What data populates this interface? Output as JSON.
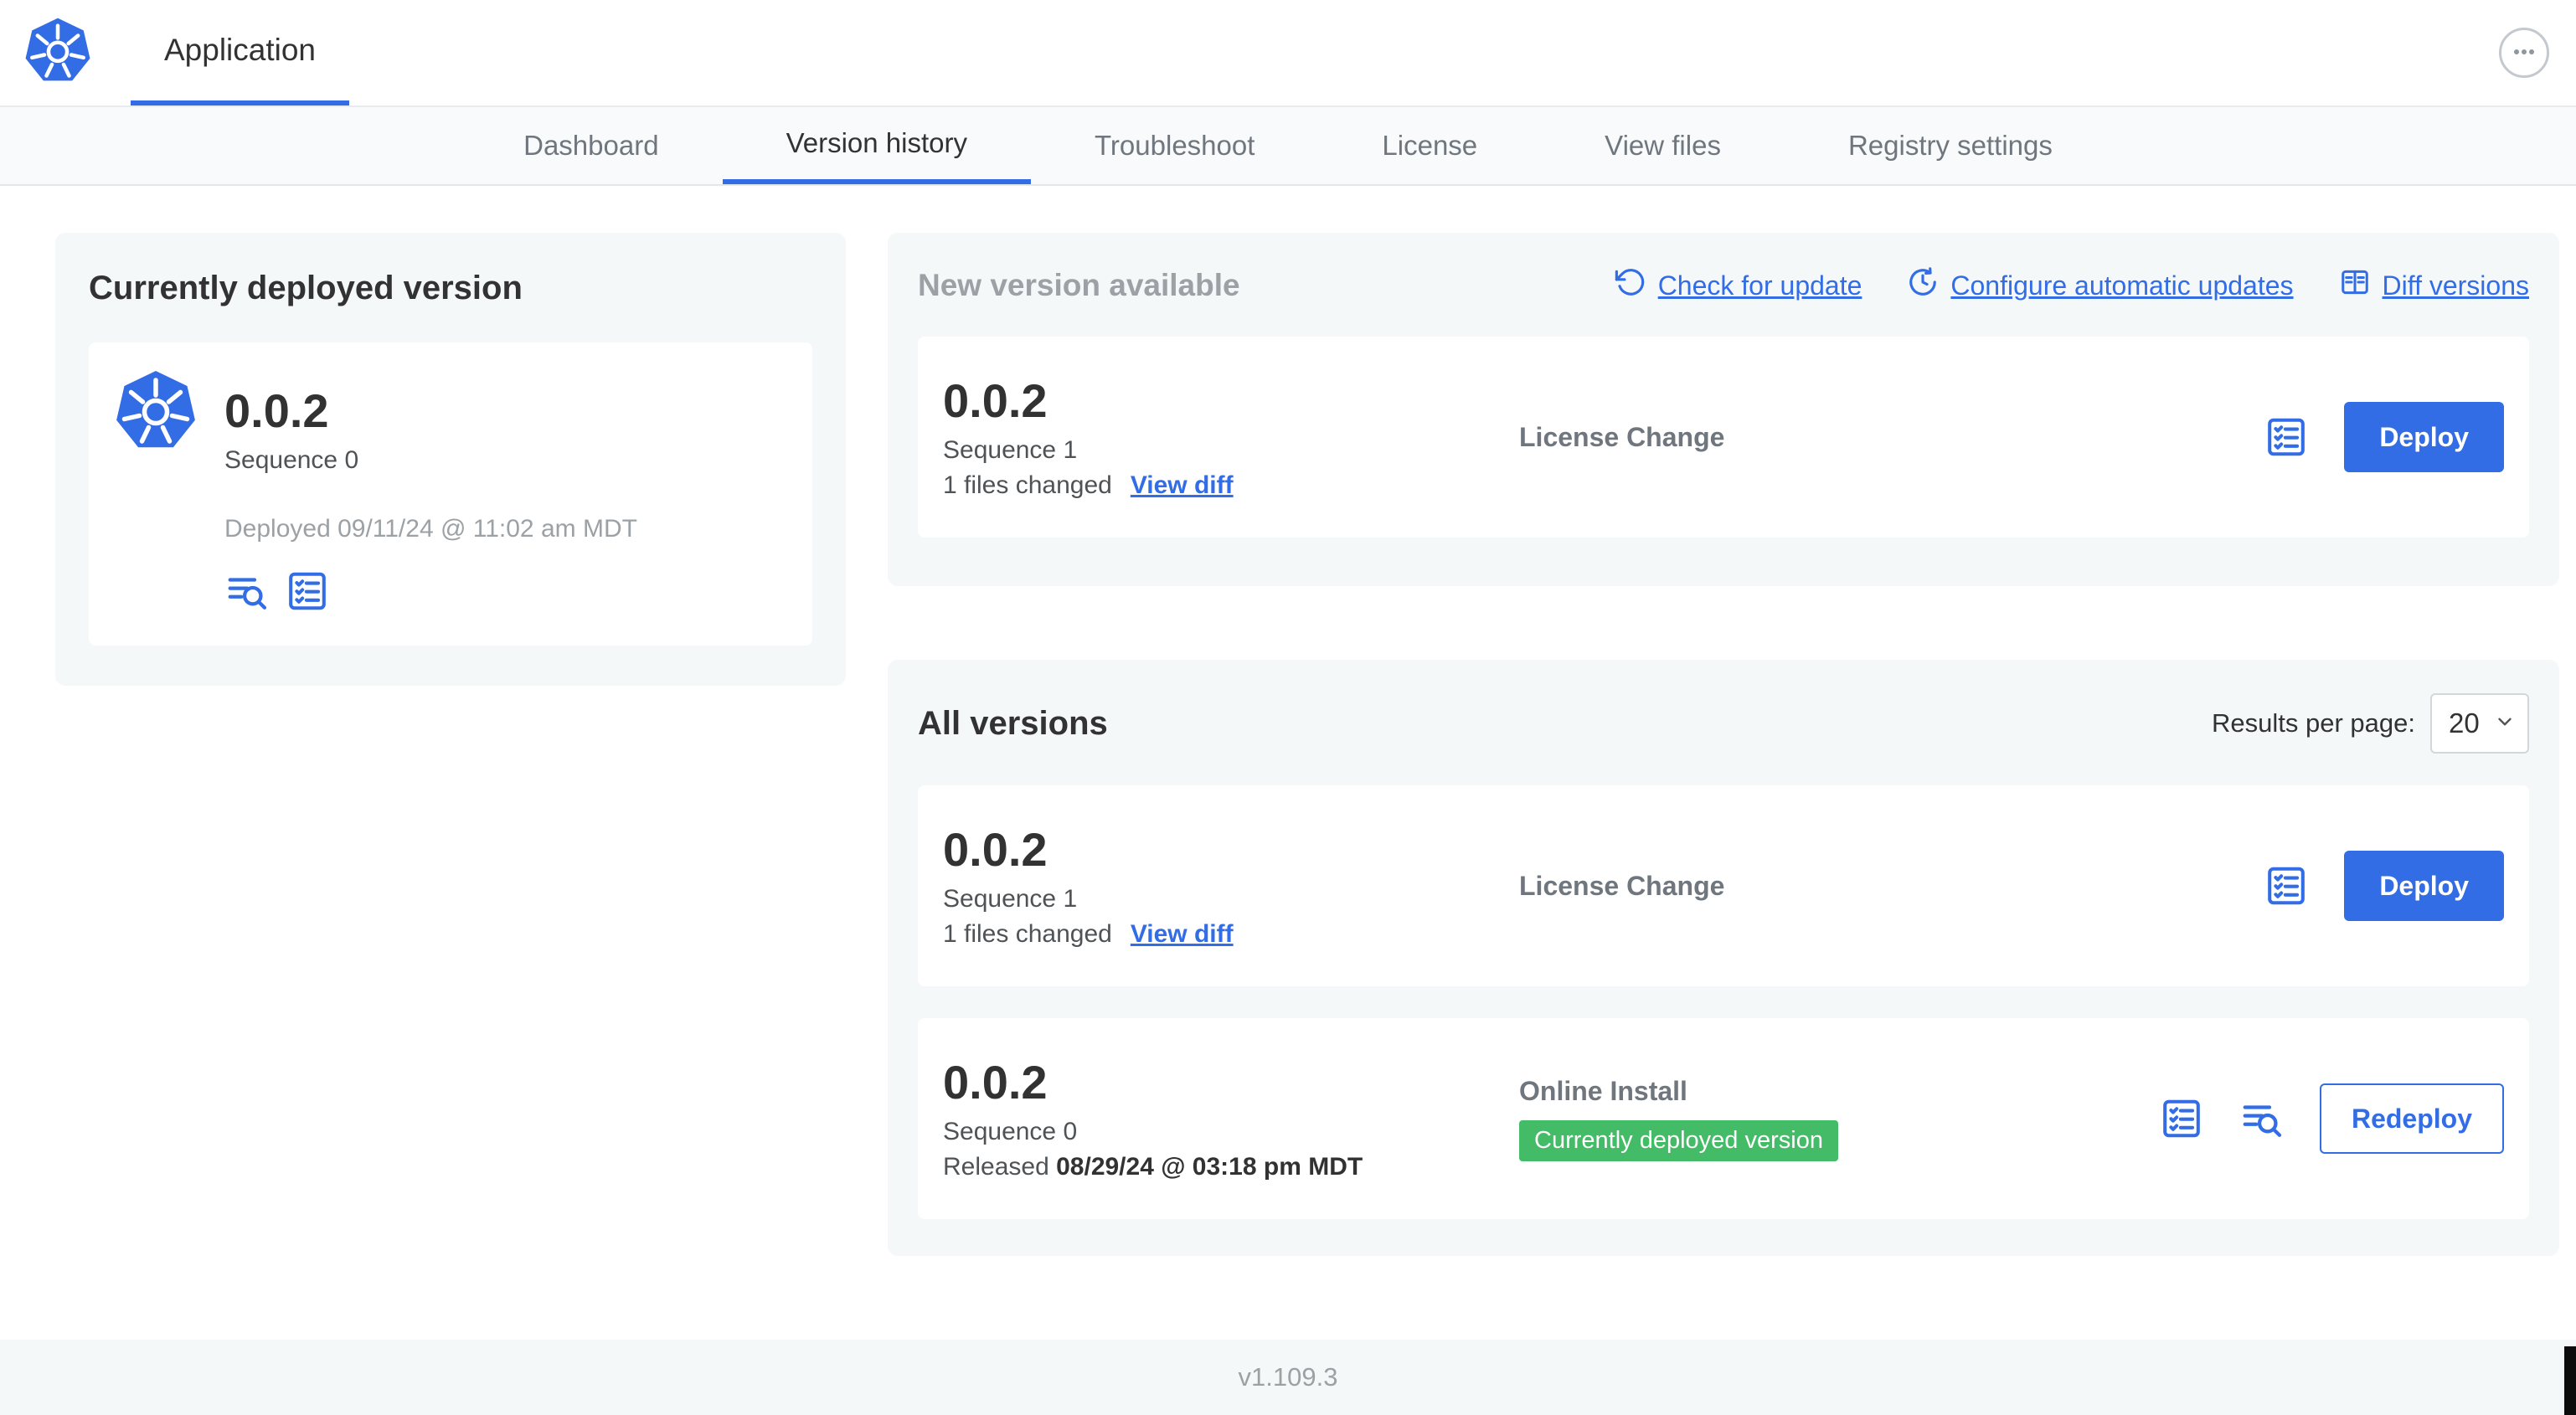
{
  "colors": {
    "accent_blue": "#326de6",
    "badge_green": "#44bb66",
    "card_bg": "#f5f8f9"
  },
  "topbar": {
    "app_tab_label": "Application"
  },
  "nav": {
    "active_tab": "Version history",
    "tabs": [
      {
        "label": "Dashboard"
      },
      {
        "label": "Version history"
      },
      {
        "label": "Troubleshoot"
      },
      {
        "label": "License"
      },
      {
        "label": "View files"
      },
      {
        "label": "Registry settings"
      }
    ]
  },
  "current_version": {
    "title": "Currently deployed version",
    "version": "0.0.2",
    "sequence": "Sequence 0",
    "deployed_at": "Deployed 09/11/24 @ 11:02 am MDT"
  },
  "new_version": {
    "title": "New version available",
    "check_for_update_label": "Check for update",
    "configure_updates_label": "Configure automatic updates",
    "diff_versions_label": "Diff versions",
    "release": {
      "version": "0.0.2",
      "sequence": "Sequence 1",
      "files_changed": "1 files changed",
      "view_diff_label": "View diff",
      "source": "License Change",
      "deploy_label": "Deploy"
    }
  },
  "all_versions": {
    "title": "All versions",
    "results_per_page_label": "Results per page:",
    "results_per_page_value": "20",
    "rows": [
      {
        "version": "0.0.2",
        "sequence": "Sequence 1",
        "files_changed": "1 files changed",
        "view_diff_label": "View diff",
        "source": "License Change",
        "action_label": "Deploy"
      },
      {
        "version": "0.0.2",
        "sequence": "Sequence 0",
        "released_label": "Released",
        "released_at": "08/29/24 @ 03:18 pm MDT",
        "source": "Online Install",
        "status_badge": "Currently deployed version",
        "action_label": "Redeploy"
      }
    ]
  },
  "footer": {
    "version": "v1.109.3"
  }
}
